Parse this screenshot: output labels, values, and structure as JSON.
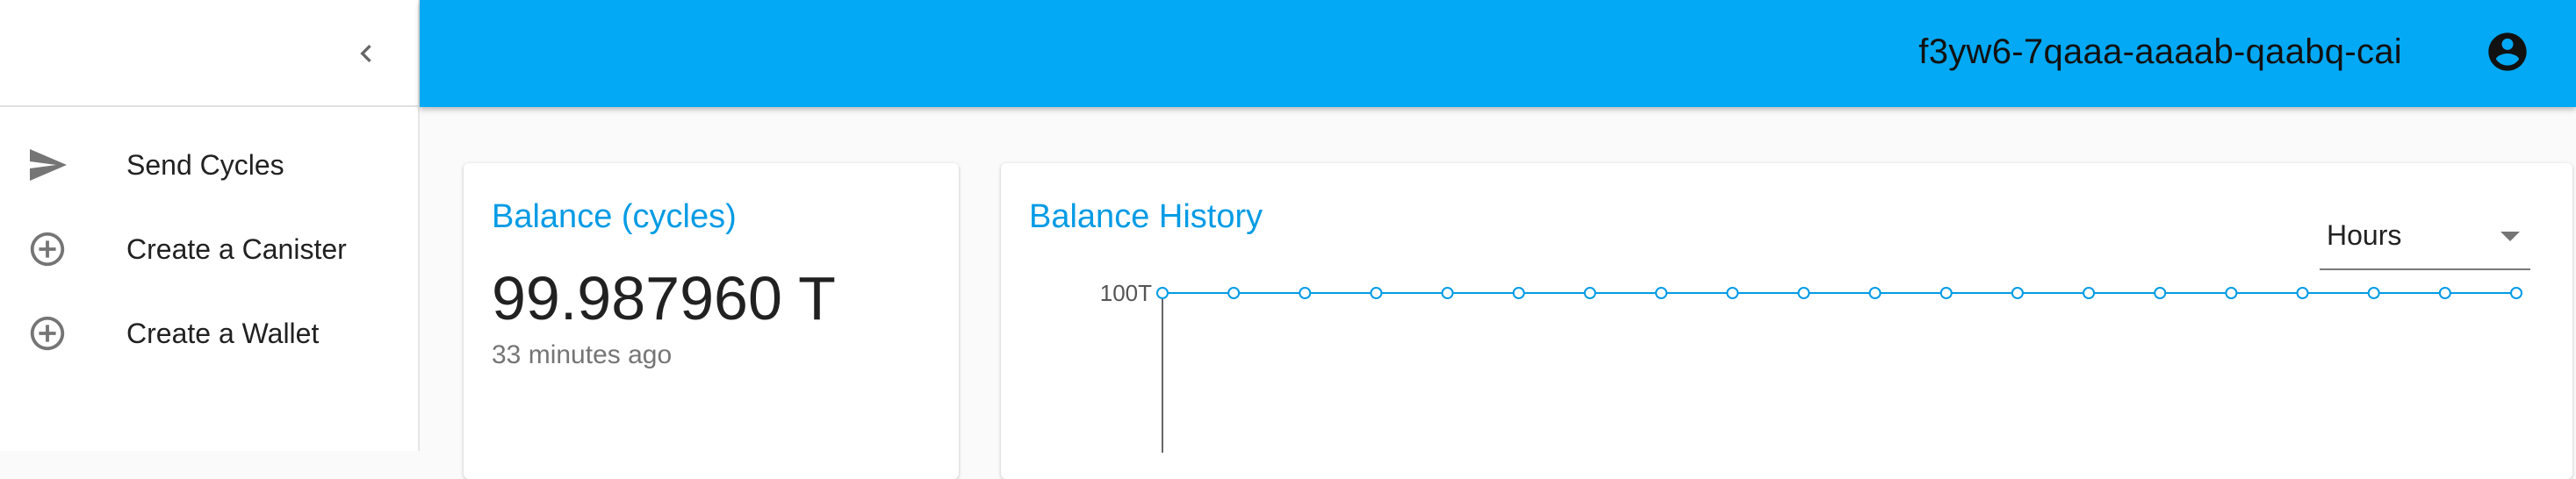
{
  "sidebar": {
    "collapse_icon": "chevron-left-icon",
    "items": [
      {
        "label": "Send Cycles",
        "icon": "send-icon"
      },
      {
        "label": "Create a Canister",
        "icon": "add-circle-outline-icon"
      },
      {
        "label": "Create a Wallet",
        "icon": "add-circle-outline-icon"
      }
    ]
  },
  "header": {
    "principal": "f3yw6-7qaaa-aaaab-qaabq-cai",
    "account_icon": "account-circle-icon",
    "background_color": "#03a9f4"
  },
  "balance_card": {
    "title": "Balance (cycles)",
    "value": "99.987960 T",
    "updated": "33 minutes ago"
  },
  "history_card": {
    "title": "Balance History",
    "select": {
      "selected": "Hours"
    }
  },
  "chart_data": {
    "type": "line",
    "series": [
      {
        "values": [
          100,
          100,
          100,
          100,
          100,
          100,
          100,
          100,
          100,
          100,
          100,
          100,
          100,
          100,
          100,
          100,
          100,
          100,
          100,
          100
        ]
      }
    ],
    "y_ticks": [
      "100T"
    ],
    "line_color": "#039be5"
  }
}
